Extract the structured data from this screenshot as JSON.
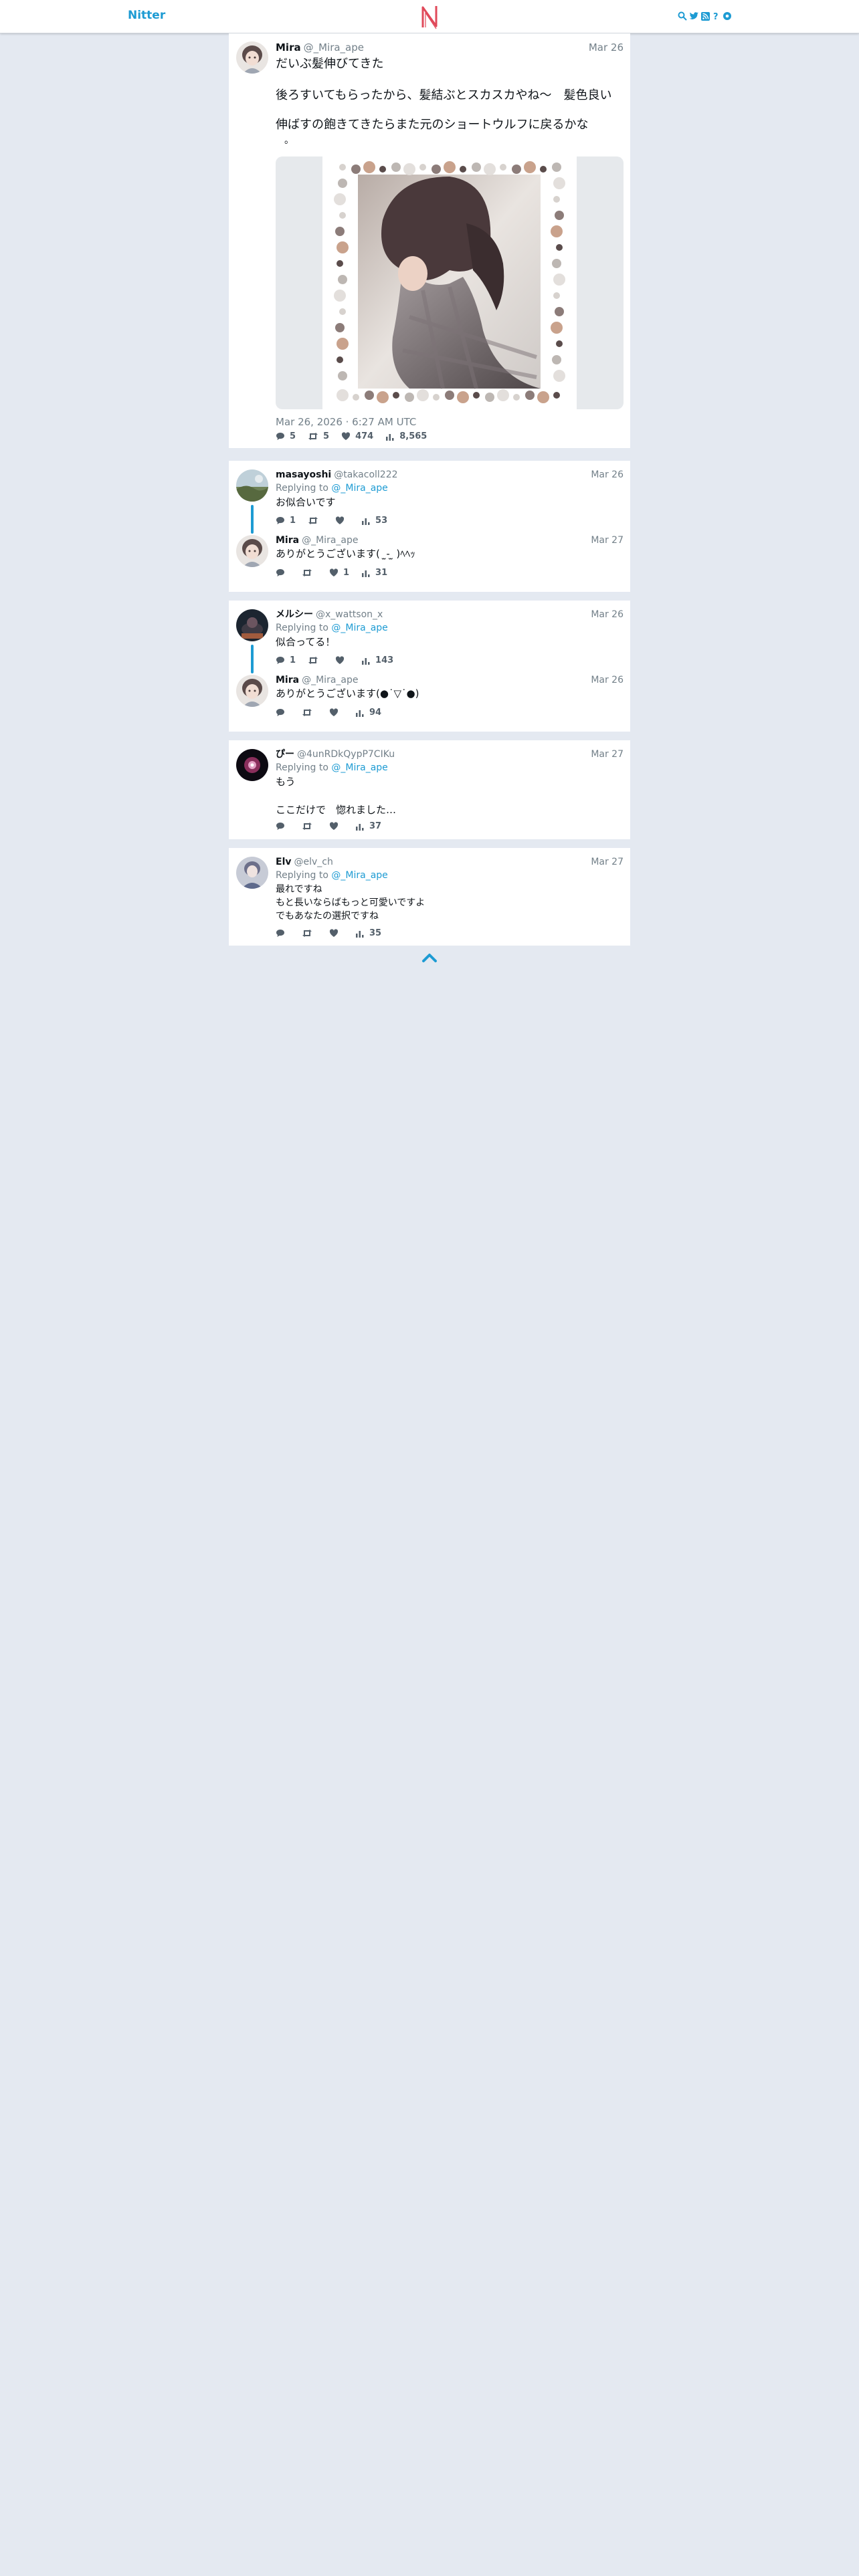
{
  "nav": {
    "brand": "Nitter",
    "logo_letter": "N",
    "icons": [
      "search-icon",
      "twitter-bird-icon",
      "rss-icon",
      "info-icon",
      "gear-icon"
    ]
  },
  "colors": {
    "accent": "#1d9bd3",
    "background": "#e4e9f1",
    "card": "#ffffff",
    "muted": "#738089"
  },
  "main_tweet": {
    "fullname": "Mira",
    "username": "@_Mira_ape",
    "date": "Mar 26",
    "text_line1": "だいぶ髪伸びてきた",
    "text_line2": "後ろすいてもらったから、髪結ぶとスカスカやね～　髪色良い",
    "text_line3": "伸ばすの飽きてきたらまた元のショートウルフに戻るかな",
    "text_line4": "。",
    "published": "Mar 26, 2026 · 6:27 AM UTC",
    "stats": {
      "replies": "5",
      "retweets": "5",
      "likes": "474",
      "views": "8,565"
    }
  },
  "threads": [
    {
      "tweets": [
        {
          "fullname": "masayoshi",
          "username": "@takacoll222",
          "date": "Mar 26",
          "replying_label": "Replying to",
          "replying_to": "@_Mira_ape",
          "text": "お似合いです",
          "stats": {
            "replies": "1",
            "retweets": "",
            "likes": "",
            "views": "53"
          }
        },
        {
          "fullname": "Mira",
          "username": "@_Mira_ape",
          "date": "Mar 27",
          "text": "ありがとうございます(  ̫- ̫ )ﾍﾍｯ",
          "stats": {
            "replies": "",
            "retweets": "",
            "likes": "1",
            "views": "31"
          }
        }
      ]
    },
    {
      "tweets": [
        {
          "fullname": "メルシー",
          "username": "@x_wattson_x",
          "date": "Mar 26",
          "replying_label": "Replying to",
          "replying_to": "@_Mira_ape",
          "text": "似合ってる！",
          "stats": {
            "replies": "1",
            "retweets": "",
            "likes": "",
            "views": "143"
          }
        },
        {
          "fullname": "Mira",
          "username": "@_Mira_ape",
          "date": "Mar 26",
          "text": "ありがとうございます(●˙▽˙●)",
          "stats": {
            "replies": "",
            "retweets": "",
            "likes": "",
            "views": "94"
          }
        }
      ]
    },
    {
      "tweets": [
        {
          "fullname": "ぴー",
          "username": "@4unRDkQypP7CIKu",
          "date": "Mar 27",
          "replying_label": "Replying to",
          "replying_to": "@_Mira_ape",
          "text": "もう\n\nここだけで　惚れました…",
          "stats": {
            "replies": "",
            "retweets": "",
            "likes": "",
            "views": "37"
          }
        }
      ]
    },
    {
      "tweets": [
        {
          "fullname": "Elv",
          "username": "@elv_ch",
          "date": "Mar 27",
          "replying_label": "Replying to",
          "replying_to": "@_Mira_ape",
          "text": "最れですね\nもと長いならばもっと可愛いですよ\nでもあなたの選択ですね",
          "stats": {
            "replies": "",
            "retweets": "",
            "likes": "",
            "views": "35"
          }
        }
      ]
    }
  ]
}
